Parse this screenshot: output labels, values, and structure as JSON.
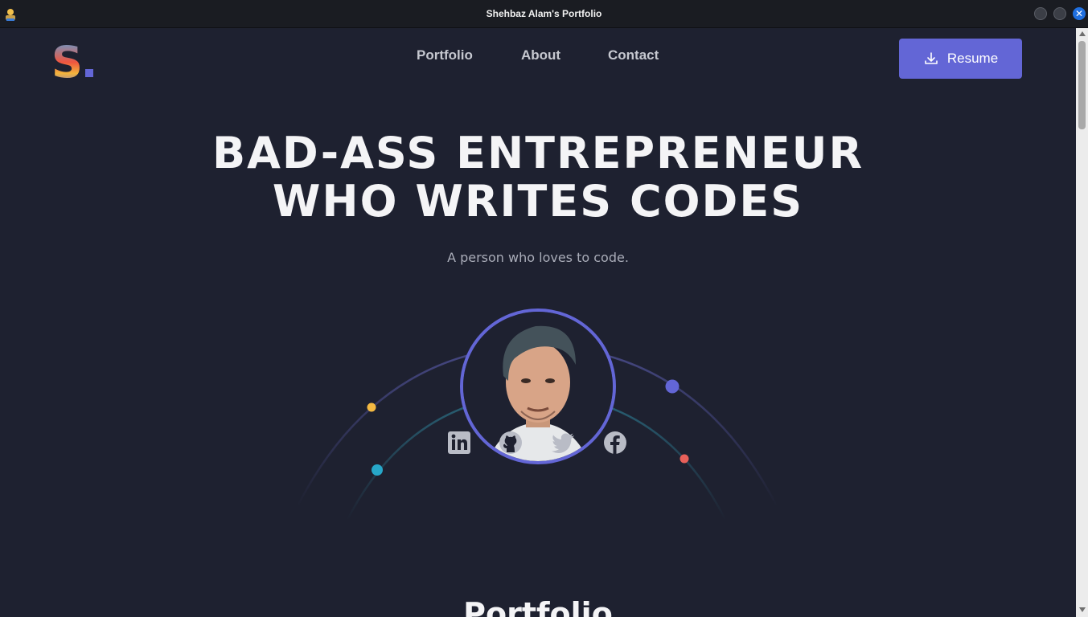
{
  "window": {
    "title": "Shehbaz Alam's Portfolio"
  },
  "header": {
    "nav": [
      {
        "label": "Portfolio"
      },
      {
        "label": "About"
      },
      {
        "label": "Contact"
      }
    ],
    "resume_label": "Resume"
  },
  "hero": {
    "title_line1": "BAD-ASS ENTREPRENEUR",
    "title_line2": "WHO WRITES CODES",
    "subtitle": "A person who loves to code."
  },
  "social_icons": [
    "linkedin-icon",
    "github-icon",
    "twitter-icon",
    "facebook-icon"
  ],
  "next_section": {
    "heading": "Portfolio"
  },
  "colors": {
    "background": "#1e2130",
    "accent": "#6366d6",
    "dot_orange": "#f4b942",
    "dot_teal": "#27a7c9",
    "dot_purple": "#6366d6",
    "dot_red": "#e8605a"
  }
}
